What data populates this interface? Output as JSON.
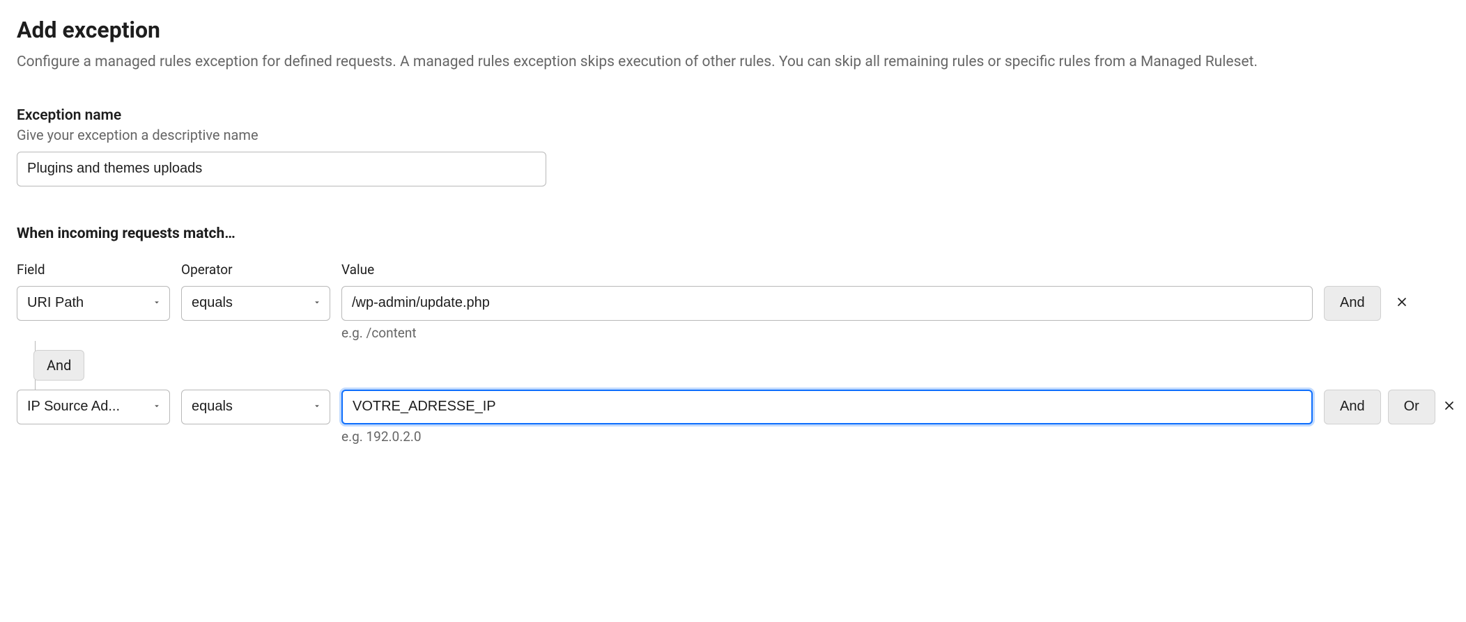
{
  "header": {
    "title": "Add exception",
    "description": "Configure a managed rules exception for defined requests. A managed rules exception skips execution of other rules. You can skip all remaining rules or specific rules from a Managed Ruleset."
  },
  "name_section": {
    "label": "Exception name",
    "hint": "Give your exception a descriptive name",
    "value": "Plugins and themes uploads"
  },
  "match_section": {
    "title": "When incoming requests match…",
    "columns": {
      "field": "Field",
      "operator": "Operator",
      "value": "Value"
    },
    "rows": [
      {
        "field": "URI Path",
        "operator": "equals",
        "value": "/wp-admin/update.php",
        "value_hint": "e.g. /content",
        "focused": false,
        "actions": [
          "And"
        ]
      },
      {
        "field": "IP Source Ad...",
        "operator": "equals",
        "value": "VOTRE_ADRESSE_IP",
        "value_hint": "e.g. 192.0.2.0",
        "focused": true,
        "actions": [
          "And",
          "Or"
        ]
      }
    ],
    "connector": "And"
  }
}
